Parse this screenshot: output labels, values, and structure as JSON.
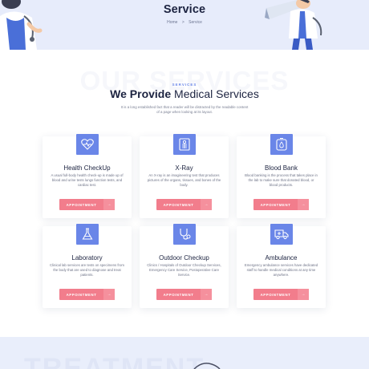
{
  "hero": {
    "title": "Service",
    "breadcrumb": {
      "home": "Home",
      "separator": ">",
      "current": "Service"
    },
    "bg_color": "#e7ecfb"
  },
  "services": {
    "background_word": "OUR SERVICES",
    "eyebrow": "SERVICES",
    "heading_bold": "We Provide",
    "heading_rest": " Medical Services",
    "subtitle": "It is a long established fact that a reader will be distracted by the readable content of a page when looking at its layout.",
    "accent_color": "#6a86e8",
    "button_color": "#f27d8c",
    "cards": [
      {
        "icon": "heart-monitor-icon",
        "title": "Health CheckUp",
        "text": "A usual full-body health check-up is made up of blood and urine tests lungs function tests, and cardiac test.",
        "button": "APPOINTMENT",
        "arrow": "→"
      },
      {
        "icon": "xray-icon",
        "title": "X-Ray",
        "text": "An X-ray is an imagineering test that produces pictures of the organs, tissues, and bones of the body.",
        "button": "APPOINTMENT",
        "arrow": "→"
      },
      {
        "icon": "blood-drop-icon",
        "title": "Blood Bank",
        "text": "Blood banking is the process that takes place in the lab to make sure that donated blood, or blood products.",
        "button": "APPOINTMENT",
        "arrow": "→"
      },
      {
        "icon": "flask-icon",
        "title": "Laboratory",
        "text": "Clinical lab services are tests on specimens from the body that are used to diagnose and treat patients.",
        "button": "APPOINTMENT",
        "arrow": "→"
      },
      {
        "icon": "stethoscope-icon",
        "title": "Outdoor Checkup",
        "text": "Clinics / Hospitals of Outdoor Checkup Services, Emergency Care Service, Postoperative Care Service.",
        "button": "APPOINTMENT",
        "arrow": "→"
      },
      {
        "icon": "ambulance-icon",
        "title": "Ambulance",
        "text": "Emergency ambulance services have dedicated staff to handle medical conditions at any time anywhere.",
        "button": "APPOINTMENT",
        "arrow": "→"
      }
    ]
  },
  "treatment": {
    "background_word": "TREATMENT"
  }
}
